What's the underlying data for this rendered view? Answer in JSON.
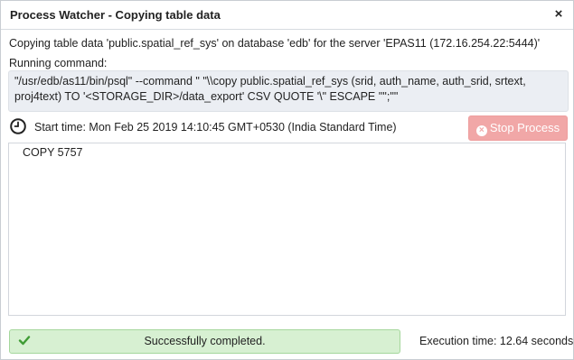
{
  "window": {
    "title": "Process Watcher - Copying table data",
    "close_icon": "×"
  },
  "info": {
    "description": "Copying table data 'public.spatial_ref_sys' on database 'edb' for the server 'EPAS11 (172.16.254.22:5444)'",
    "running_label": "Running command:",
    "command_line1": "\"/usr/edb/as11/bin/psql\" --command \" \"\\\\copy public.spatial_ref_sys (srid, auth_name, auth_srid, srtext,",
    "command_line2": "proj4text) TO '<STORAGE_DIR>/data_export' CSV QUOTE '\\\" ESCAPE '\"';\"\""
  },
  "process": {
    "start_time": "Start time: Mon Feb 25 2019 14:10:45 GMT+0530 (India Standard Time)",
    "stop_label": "Stop Process",
    "output": "COPY 5757"
  },
  "footer": {
    "status_text": "Successfully completed.",
    "execution_time": "Execution time: 12.64 seconds"
  },
  "colors": {
    "stop_button": "#f1a7a7",
    "success_bg": "#d7f0d2",
    "success_check": "#3f9c35"
  }
}
